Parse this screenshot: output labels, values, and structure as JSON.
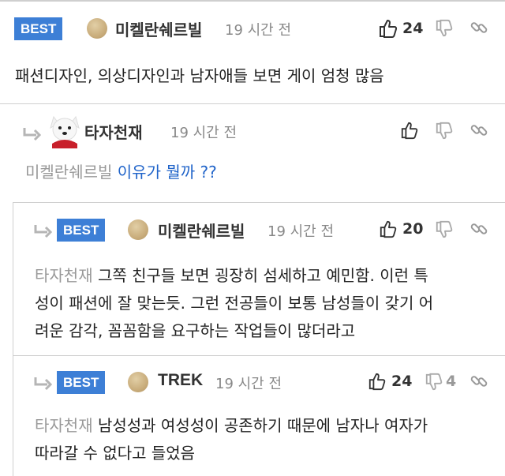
{
  "comments": [
    {
      "best": "BEST",
      "author": "미켈란쉐르빌",
      "time": "19 시간 전",
      "likes": "24",
      "text": "패션디자인, 의상디자인과 남자애들 보면 게이 엄청 많음"
    },
    {
      "author": "타자천재",
      "time": "19 시간 전",
      "mention": "미켈란쉐르빌",
      "text": "이유가 뭘까 ??"
    },
    {
      "best": "BEST",
      "author": "미켈란쉐르빌",
      "time": "19 시간 전",
      "likes": "20",
      "mention": "타자천재",
      "text_line1": "그쪽 친구들 보면 굉장히 섬세하고 예민함. 이런 특",
      "text_line2": "성이 패션에 잘 맞는듯. 그런 전공들이 보통 남성들이 갖기 어",
      "text_line3": "려운 감각, 꼼꼼함을 요구하는 작업들이 많더라고"
    },
    {
      "best": "BEST",
      "author": "TREK",
      "time": "19 시간 전",
      "likes": "24",
      "dislikes": "4",
      "mention": "타자천재",
      "text_line1": "남성성과 여성성이 공존하기 때문에 남자나 여자가",
      "text_line2": "따라갈 수 없다고 들었음"
    }
  ],
  "icons": [
    "thumbs-up-icon",
    "thumbs-down-icon",
    "link-icon",
    "reply-arrow-icon",
    "dog-avatar"
  ],
  "colors": {
    "best_badge": "#3d7fd6",
    "question_text": "#1f63c9"
  }
}
